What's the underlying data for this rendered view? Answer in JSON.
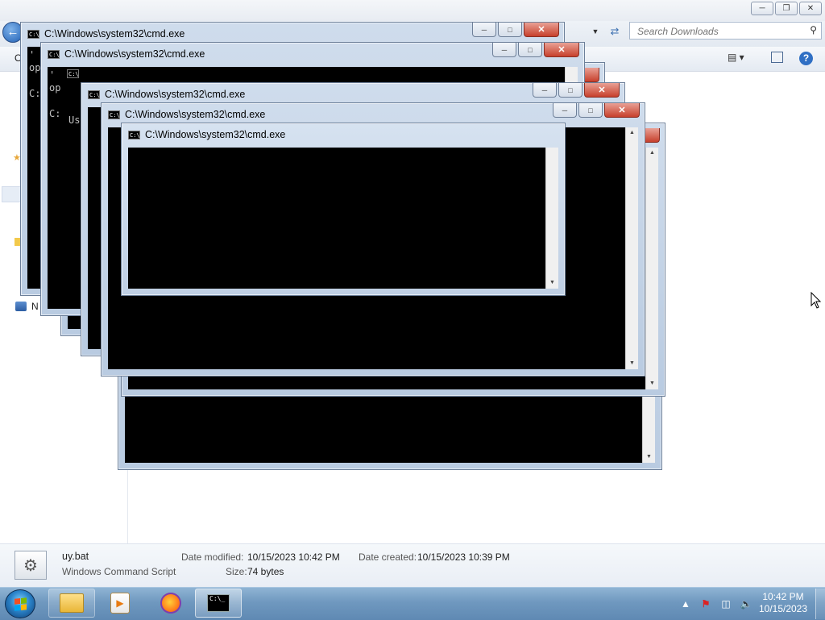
{
  "explorer": {
    "search_placeholder": "Search Downloads",
    "organize_label": "O",
    "network_label": "N",
    "status": {
      "file_name": "uy.bat",
      "file_type": "Windows Command Script",
      "modified_label": "Date modified:",
      "modified_value": "10/15/2023 10:42 PM",
      "created_label": "Date created:",
      "created_value": "10/15/2023 10:39 PM",
      "size_label": "Size:",
      "size_value": "74 bytes"
    }
  },
  "cmd_windows": [
    {
      "title": "C:\\Windows\\system32\\cmd.exe",
      "content": "'\nop\n\nC:"
    },
    {
      "title": "C:\\Windows\\system32\\cmd.exe",
      "content": "'\nop\n\nC:"
    },
    {
      "title": "C:\\Windows\\system32\\cmd.exe",
      "content": "\n\nUs"
    },
    {
      "title": "C:\\Windows\\system32\\cmd.exe",
      "content": ""
    },
    {
      "title": "C:\\Windows\\system32\\cmd.exe",
      "content": ""
    },
    {
      "title": "C:\\Windows\\system32\\cmd.exe",
      "content": ""
    }
  ],
  "taskbar": {
    "apps": [
      "windows-explorer",
      "windows-media-player",
      "firefox",
      "command-prompt"
    ],
    "clock_time": "10:42 PM",
    "clock_date": "10/15/2023"
  },
  "colors": {
    "console_bg": "#000000",
    "title_bar": "#c4d4e8",
    "taskbar": "#6f98bf",
    "close_button": "#c7402c"
  }
}
